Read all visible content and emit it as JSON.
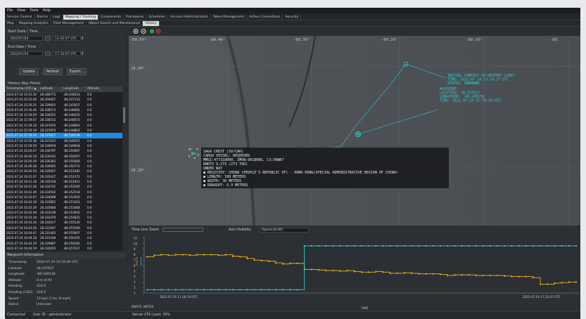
{
  "menu": [
    "File",
    "View",
    "Tools",
    "Help"
  ],
  "main_tabs": [
    {
      "label": "Service Control",
      "active": false
    },
    {
      "label": "Alarms",
      "active": false
    },
    {
      "label": "Logs",
      "active": false
    },
    {
      "label": "Mapping / Tracking",
      "active": true
    },
    {
      "label": "Components",
      "active": false
    },
    {
      "label": "Procedures",
      "active": false
    },
    {
      "label": "Schedules",
      "active": false
    },
    {
      "label": "Account Administration",
      "active": false
    },
    {
      "label": "Token Management",
      "active": false
    },
    {
      "label": "Active Connections",
      "active": false
    },
    {
      "label": "Security",
      "active": false
    }
  ],
  "sub_tabs": [
    {
      "label": "Map",
      "active": false
    },
    {
      "label": "Mapping Analytics",
      "active": false
    },
    {
      "label": "Fleet Management",
      "active": false
    },
    {
      "label": "Object Search and Maintenance",
      "active": false
    },
    {
      "label": "History",
      "active": true
    }
  ],
  "history": {
    "start_label": "Start Date / Time",
    "start_date": "2022/07/24",
    "start_time": "11:32:07 UTC",
    "end_label": "End Date / Time",
    "end_date": "2022/07/24",
    "end_time": "17:32:07 UTC",
    "update_button": "Update",
    "refresh_button": "Refresh",
    "export_button": "Export...",
    "waypoints_label": "History Way Points"
  },
  "table": {
    "columns": [
      "Timestamp (UTC) ▲",
      "Latitude",
      "Longitude",
      "Altitude"
    ],
    "selected_index": 8,
    "rows": [
      [
        "2022.07.24 15.51.39",
        "28.348773",
        "-80.246033",
        "0.0"
      ],
      [
        "2022.07.24 15.55.09",
        "28.359457",
        "-80.247133",
        "0.0"
      ],
      [
        "2022.07.24 15.56.25",
        "28.339925",
        "-80.247627",
        "0.0"
      ],
      [
        "2022.07.24 15.56.46",
        "28.338573",
        "-80.248092",
        "0.0"
      ],
      [
        "2022.07.24 15.56.59",
        "28.338355",
        "-80.248335",
        "0.0"
      ],
      [
        "2022.07.24 15.59.07",
        "28.338152",
        "-80.248553",
        "0.0"
      ],
      [
        "2022.07.24 15.59.18",
        "28.337870",
        "-80.248863",
        "0.0"
      ],
      [
        "2022.07.24 15.59.18",
        "28.337870",
        "-80.248863",
        "0.0"
      ],
      [
        "2022.07.24 15.59.29",
        "28.337627",
        "-80.249138",
        "0.0"
      ],
      [
        "2022.07.24 15.59.38",
        "28.337415",
        "-80.249355",
        "0.0"
      ],
      [
        "2022.07.24 15.59.59",
        "28.336978",
        "-80.249828",
        "0.0"
      ],
      [
        "2022.07.24 16.00.07",
        "28.336797",
        "-80.250067",
        "0.0"
      ],
      [
        "2022.07.24 16.00.18",
        "28.336543",
        "-80.250297",
        "0.0"
      ],
      [
        "2022.07.24 16.00.29",
        "28.336302",
        "-80.250560",
        "0.0"
      ],
      [
        "2022.07.24 16.00.38",
        "28.336095",
        "-80.250772",
        "0.0"
      ],
      [
        "2022.07.24 16.00.59",
        "28.335657",
        "-80.251085",
        "0.0"
      ],
      [
        "2022.07.24 16.01.07",
        "28.335437",
        "-80.251572",
        "0.0"
      ],
      [
        "2022.07.24 16.01.18",
        "28.335218",
        "-80.251815",
        "0.0"
      ],
      [
        "2022.07.24 16.01.28",
        "28.334732",
        "-80.252295",
        "0.0"
      ],
      [
        "2022.07.24 16.01.49",
        "28.334502",
        "-80.252518",
        "0.0"
      ],
      [
        "2022.07.24 16.02.07",
        "28.334098",
        "-80.252950",
        "0.0"
      ],
      [
        "2022.07.24 16.02.18",
        "28.333852",
        "-80.253203",
        "0.0"
      ],
      [
        "2022.07.24 16.02.29",
        "28.333608",
        "-80.253468",
        "0.0"
      ],
      [
        "2022.07.24 16.02.49",
        "28.333148",
        "-80.253945",
        "0.0"
      ],
      [
        "2022.07.24 16.03.18",
        "28.332478",
        "-80.254625",
        "0.0"
      ],
      [
        "2022.07.24 16.03.39",
        "28.332017",
        "-80.255130",
        "0.0"
      ],
      [
        "2022.07.24 16.03.58",
        "28.331597",
        "-80.255590",
        "0.0"
      ],
      [
        "2022.07.24 16.04.07",
        "28.331403",
        "-80.255807",
        "0.0"
      ],
      [
        "2022.07.24 16.04.18",
        "28.331168",
        "-80.256105",
        "0.0"
      ],
      [
        "2022.07.24 16.04.39",
        "28.330687",
        "-80.256582",
        "0.0"
      ],
      [
        "2022.07.24 16.04.59",
        "28.330250",
        "-80.257027",
        "0.0"
      ],
      [
        "2022.07.24 16.05.18",
        "28.329827",
        "-80.257515",
        "0.0"
      ],
      [
        "2022.07.24 16.05.38",
        "28.329085",
        "-80.257862",
        "0.0"
      ]
    ]
  },
  "waypoint_info": {
    "header": "Waypoint Information",
    "rows": [
      {
        "k": "Timestamp",
        "v": "2022.07.24 15.59.29 UTC"
      },
      {
        "k": "Latitude",
        "v": "28.337627"
      },
      {
        "k": "Longitude",
        "v": "-80.249138"
      },
      {
        "k": "Altitude",
        "v": "0 m (0 ft)"
      },
      {
        "k": "Heading",
        "v": "224.0"
      },
      {
        "k": "Heading (COG)",
        "v": "224.0"
      },
      {
        "k": "Speed",
        "v": "13 kph (7 kn, 8 mph)"
      },
      {
        "k": "Status",
        "v": "Unknown"
      }
    ]
  },
  "map": {
    "lon_labels": [
      "-80.50°",
      "-80.40°",
      "-80.30°",
      "-80.20°",
      "-80.10°",
      "-80."
    ],
    "lat_labels": [
      "28.40°",
      "28.30°"
    ],
    "initial_contact": [
      "INITIAL CONTACT OR HISTORY LIMIT",
      "TIME: 2022.07.24 13.24.27 UTC",
      "STATUS: UNKNOWN"
    ],
    "waypoint_callout": [
      "WAYPOINT",
      "LATITUDE: 28.337627",
      "LONGITUDE: -80.249138",
      "TIME: 2022.07.24 15.59.29 UTC"
    ],
    "vessel_info": [
      "SAGA CREST (SV/CAR)",
      "CARGO VESSEL: RESERVED",
      "MMSI:477318000, IMON:9018086, CS:VRWR7",
      "KNOTS 9.273 (273 TOD)",
      "UNDER WAY",
      "● REGISTRY: CHINA (PEOPLE'S REPUBLIC OF) - HONG KONG(SPECIAL ADMINISTRATIVE REGION OF CHINA)",
      "● LENGTH: 180 METERS",
      "● WIDTH: 30 METERS",
      "● DRAUGHT: 6.9 METERS"
    ],
    "colors": {
      "track": "#2bd4d4",
      "vessel": "#28c45a"
    }
  },
  "timeline": {
    "zoom_label": "Time Line Zoom",
    "axis_visibility_label": "Axis Visibility",
    "axis_visibility_value": "[Speed,Draft]"
  },
  "chart_data": {
    "type": "line",
    "y_ticks": [
      "1",
      "2",
      "3",
      "4",
      "5",
      "6",
      "7",
      "8",
      "9",
      "10",
      "11"
    ],
    "left_axis_label": "KNOTS",
    "right_axis_label": "METER",
    "x_start_label": "2022.07.24 11.28.19 UTC",
    "x_end_label": "2022.07.24 17.32.07 UTC",
    "xlabel": "TIME",
    "footer_labels": [
      "KNOTS",
      "METER"
    ],
    "series": [
      {
        "color": "#e6b422",
        "values": [
          7.6,
          7.9,
          8.0,
          7.9,
          8.0,
          8.0,
          7.9,
          8.0,
          8.0,
          8.0,
          7.9,
          8.0,
          7.7,
          7.6,
          7.3,
          7.0,
          6.9,
          6.8,
          6.5,
          6.3,
          6.4,
          6.4,
          5.3,
          5.3,
          5.2,
          5.1,
          5.1,
          5.0,
          5.1,
          4.9,
          4.8,
          4.8,
          4.9,
          4.8,
          4.6,
          4.6,
          4.7,
          4.6,
          4.5,
          4.5,
          4.5,
          4.4,
          4.2,
          4.3,
          4.3,
          4.3,
          4.2,
          4.2,
          4.2,
          4.2,
          4.1,
          4.0,
          4.0,
          4.0,
          3.8,
          2.6,
          2.6,
          2.8,
          2.9,
          3.0,
          3.0
        ]
      },
      {
        "color": "#2bd4d4",
        "values": [
          1.6,
          1.6,
          1.6,
          1.6,
          1.6,
          1.6,
          1.6,
          1.6,
          1.6,
          1.6,
          1.6,
          1.6,
          1.6,
          1.6,
          1.6,
          1.6,
          1.6,
          1.6,
          1.6,
          1.6,
          1.6,
          1.6,
          9.6,
          9.6,
          9.6,
          9.6,
          9.6,
          9.6,
          9.6,
          9.6,
          9.6,
          9.6,
          9.6,
          9.6,
          9.6,
          9.6,
          9.6,
          9.6,
          9.6,
          9.6,
          9.6,
          9.6,
          9.6,
          9.6,
          9.6,
          9.6,
          9.6,
          9.6,
          9.6,
          9.6,
          9.6,
          9.6,
          9.6,
          9.6,
          9.6,
          9.6,
          9.6,
          9.6,
          9.6,
          9.6,
          9.6
        ]
      }
    ],
    "ylim": [
      1,
      11
    ]
  },
  "status": {
    "left": "Connected",
    "user": "User ID : administrator",
    "cpu": "Server CPU Load: 35%"
  }
}
